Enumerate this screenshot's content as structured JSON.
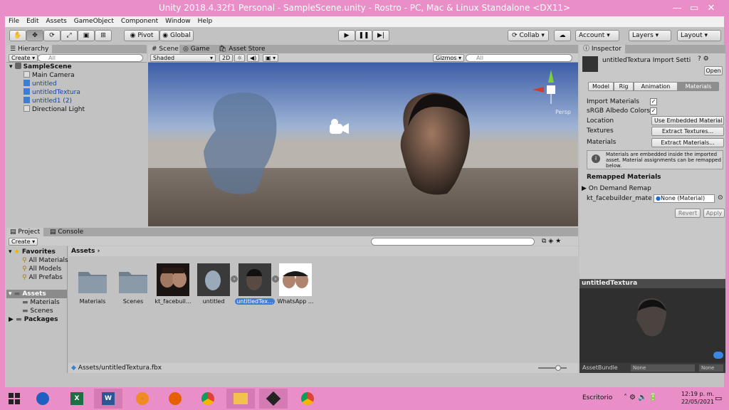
{
  "window": {
    "title": "Unity 2018.4.32f1 Personal - SampleScene.unity - Rostro - PC, Mac & Linux Standalone <DX11>"
  },
  "menu": [
    "File",
    "Edit",
    "Assets",
    "GameObject",
    "Component",
    "Window",
    "Help"
  ],
  "toolbar": {
    "pivot": "Pivot",
    "global": "Global",
    "collab": "Collab",
    "account": "Account",
    "layers": "Layers",
    "layout": "Layout"
  },
  "hierarchy": {
    "tab": "Hierarchy",
    "create": "Create",
    "search": "All",
    "scene": "SampleScene",
    "items": [
      "Main Camera",
      "untitled",
      "untitledTextura",
      "untitled1 (2)",
      "Directional Light"
    ]
  },
  "scene": {
    "tabs": [
      "Scene",
      "Game",
      "Asset Store"
    ],
    "shading": "Shaded",
    "mode2d": "2D",
    "gizmos": "Gizmos",
    "search": "All",
    "persp": "Persp"
  },
  "inspector": {
    "tab": "Inspector",
    "title": "untitledTextura Import Setti",
    "open": "Open",
    "tabs": [
      "Model",
      "Rig",
      "Animation",
      "Materials"
    ],
    "import_materials": "Import Materials",
    "srgb": "sRGB Albedo Colors",
    "location_label": "Location",
    "location_value": "Use Embedded Material",
    "textures_label": "Textures",
    "extract_textures": "Extract Textures...",
    "materials_label": "Materials",
    "extract_materials": "Extract Materials...",
    "info": "Materials are embedded inside the imported asset. Material assignments can be remapped below.",
    "remapped": "Remapped Materials",
    "on_demand": "On Demand Remap",
    "kt_label": "kt_facebuilder_mate",
    "kt_value": "None (Material)",
    "revert": "Revert",
    "apply": "Apply"
  },
  "preview": {
    "title": "untitledTextura",
    "assetbundle": "AssetBundle",
    "none1": "None",
    "none2": "None"
  },
  "project": {
    "tabs": [
      "Project",
      "Console"
    ],
    "create": "Create",
    "favorites": "Favorites",
    "fav_items": [
      "All Materials",
      "All Models",
      "All Prefabs"
    ],
    "assets": "Assets",
    "asset_folders": [
      "Materials",
      "Scenes"
    ],
    "packages": "Packages",
    "breadcrumb": "Assets",
    "items": [
      "Materials",
      "Scenes",
      "kt_facebuil...",
      "untitled",
      "untitledTex...",
      "WhatsApp ..."
    ],
    "path": "Assets/untitledTextura.fbx"
  },
  "taskbar": {
    "desktop": "Escritorio",
    "time": "12:19 p. m.",
    "date": "22/05/2021"
  }
}
